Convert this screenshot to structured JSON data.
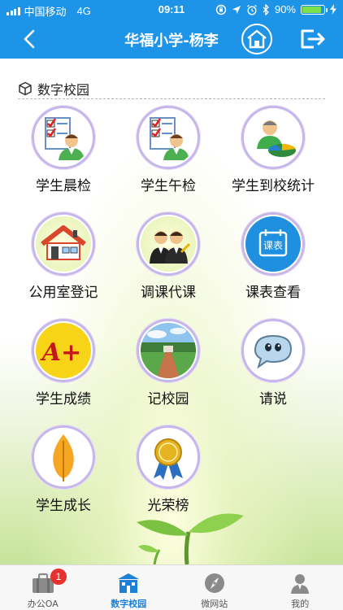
{
  "status_bar": {
    "carrier": "中国移动",
    "network": "4G",
    "time": "09:11",
    "battery": "90%",
    "battery_level": 0.9
  },
  "nav": {
    "title": "华福小学-杨李"
  },
  "section": {
    "title": "数字校园"
  },
  "tiles": [
    {
      "label": "学生晨检",
      "icon": "morning-check-icon"
    },
    {
      "label": "学生午检",
      "icon": "noon-check-icon"
    },
    {
      "label": "学生到校统计",
      "icon": "arrival-stats-icon"
    },
    {
      "label": "公用室登记",
      "icon": "public-room-icon"
    },
    {
      "label": "调课代课",
      "icon": "substitute-class-icon"
    },
    {
      "label": "课表查看",
      "icon": "schedule-icon",
      "icon_text": "课表"
    },
    {
      "label": "学生成绩",
      "icon": "grades-icon",
      "icon_text": "A+"
    },
    {
      "label": "记校园",
      "icon": "campus-photo-icon"
    },
    {
      "label": "请说",
      "icon": "speech-bubble-icon"
    },
    {
      "label": "学生成长",
      "icon": "leaf-icon"
    },
    {
      "label": "光荣榜",
      "icon": "honor-medal-icon"
    }
  ],
  "tabbar": {
    "items": [
      {
        "label": "办公OA",
        "icon": "briefcase-icon",
        "badge": "1"
      },
      {
        "label": "数字校园",
        "icon": "school-icon",
        "active": true
      },
      {
        "label": "微网站",
        "icon": "compass-icon"
      },
      {
        "label": "我的",
        "icon": "person-icon"
      }
    ]
  },
  "colors": {
    "primary": "#1e94e9",
    "active_tab": "#1e7fd6",
    "badge": "#e8302f",
    "ring": "#c7b6ea"
  }
}
